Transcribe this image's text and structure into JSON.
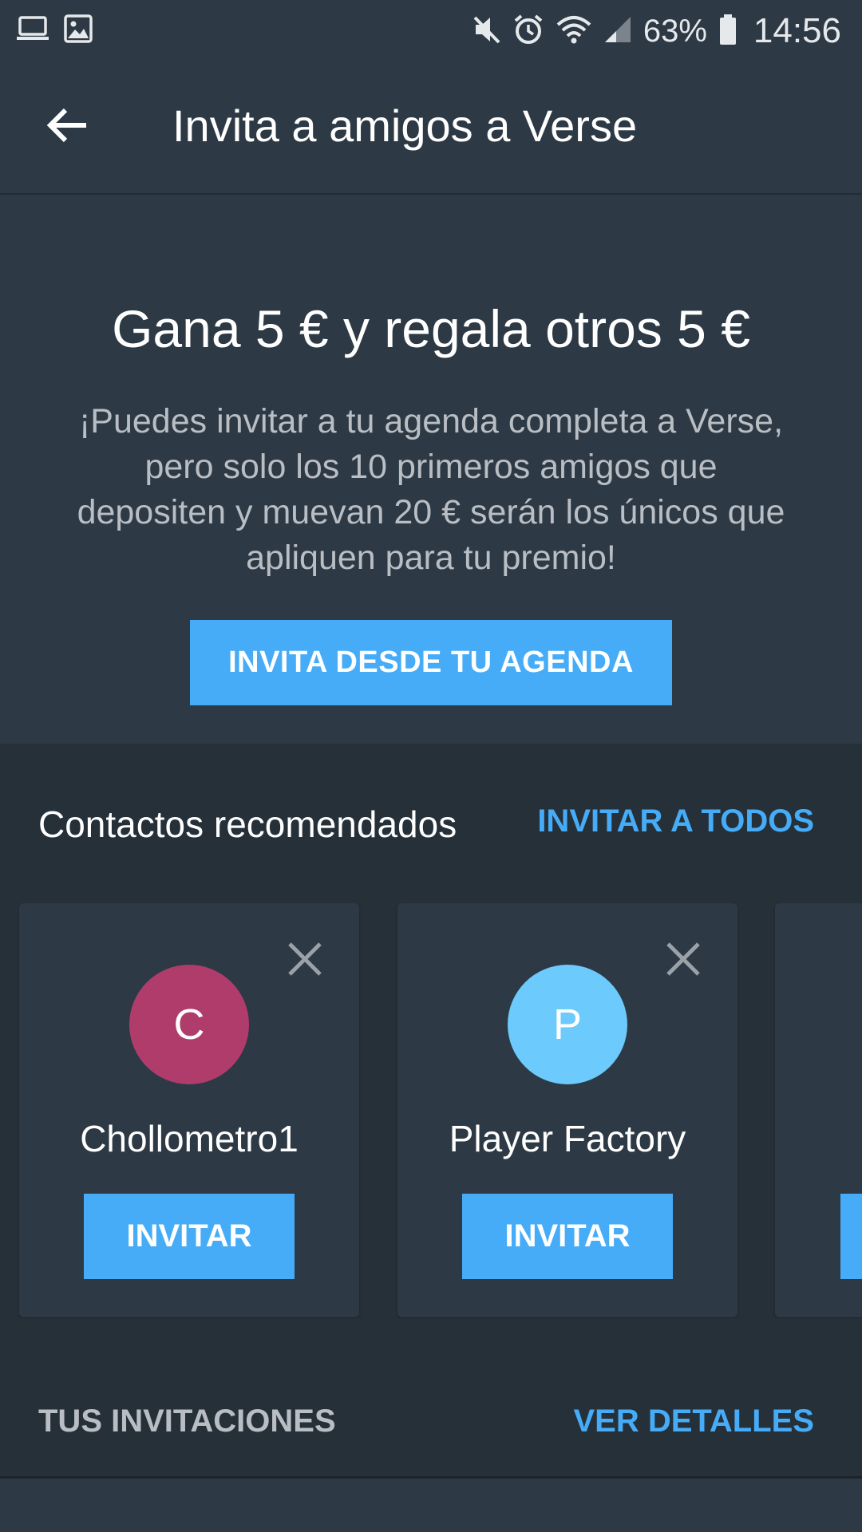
{
  "status_bar": {
    "battery": "63%",
    "time": "14:56"
  },
  "app_bar": {
    "title": "Invita a amigos a Verse"
  },
  "hero": {
    "title": "Gana 5 € y regala otros 5 €",
    "description": "¡Puedes invitar a tu agenda completa a Verse, pero solo los 10 primeros amigos que depositen y muevan 20 € serán los únicos que apliquen para tu premio!",
    "button_label": "INVITA DESDE TU AGENDA"
  },
  "recommended": {
    "title": "Contactos recomendados",
    "action_label": "INVITAR A TODOS",
    "contacts": [
      {
        "initial": "C",
        "name": "Chollometro1",
        "button_label": "INVITAR",
        "avatar_color": "#b03c6c"
      },
      {
        "initial": "P",
        "name": "Player Factory",
        "button_label": "INVITAR",
        "avatar_color": "#6ccafc"
      }
    ]
  },
  "invitations": {
    "title": "TUS INVITACIONES",
    "action_label": "VER DETALLES"
  },
  "colors": {
    "accent": "#46acf7",
    "background": "#263039",
    "surface": "#2d3944"
  }
}
